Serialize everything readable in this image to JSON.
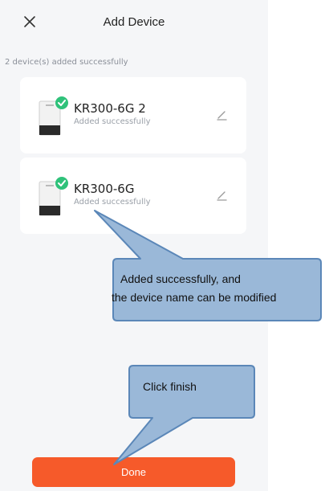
{
  "header": {
    "title": "Add Device",
    "close_icon": "close-icon"
  },
  "status_text": "2 device(s) added successfully",
  "devices": [
    {
      "name": "KR300-6G 2",
      "status": "Added successfully",
      "icon": "edit-pencil-icon"
    },
    {
      "name": "KR300-6G",
      "status": "Added successfully",
      "icon": "edit-pencil-icon"
    }
  ],
  "done_label": "Done",
  "annotations": {
    "callout1_line1": "Added successfully, and",
    "callout1_line2": "the device name can be modified",
    "callout2": "Click finish"
  },
  "colors": {
    "accent": "#f65a2a",
    "success_badge": "#2fc27a",
    "callout_fill": "#9ab8d8",
    "callout_border": "#5b87b8",
    "background": "#f5f6f8"
  }
}
